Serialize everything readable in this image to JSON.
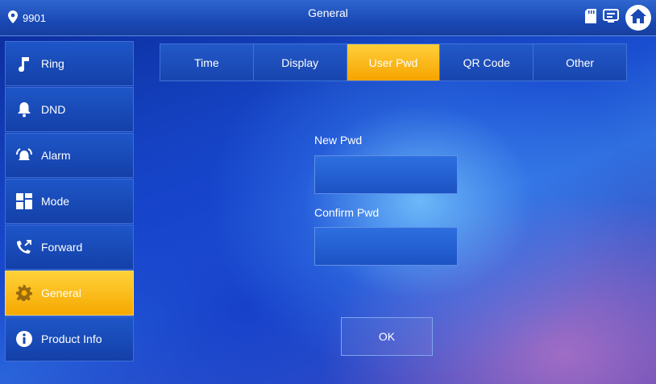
{
  "header": {
    "location_label": "9901",
    "title": "General",
    "icons": [
      "location-pin-icon",
      "sd-card-icon",
      "message-icon",
      "home-icon"
    ]
  },
  "sidebar": {
    "items": [
      {
        "label": "Ring",
        "icon": "music-note-icon",
        "active": false
      },
      {
        "label": "DND",
        "icon": "bell-icon",
        "active": false
      },
      {
        "label": "Alarm",
        "icon": "alarm-icon",
        "active": false
      },
      {
        "label": "Mode",
        "icon": "grid-icon",
        "active": false
      },
      {
        "label": "Forward",
        "icon": "phone-forward-icon",
        "active": false
      },
      {
        "label": "General",
        "icon": "gear-icon",
        "active": true
      },
      {
        "label": "Product Info",
        "icon": "info-icon",
        "active": false
      }
    ]
  },
  "tabs": [
    {
      "label": "Time",
      "active": false
    },
    {
      "label": "Display",
      "active": false
    },
    {
      "label": "User Pwd",
      "active": true
    },
    {
      "label": "QR Code",
      "active": false
    },
    {
      "label": "Other",
      "active": false
    }
  ],
  "form": {
    "new_pwd_label": "New Pwd",
    "new_pwd_value": "",
    "confirm_pwd_label": "Confirm Pwd",
    "confirm_pwd_value": "",
    "ok_label": "OK"
  },
  "colors": {
    "active_accent": "#f6a800",
    "panel_blue": "#1a49b5"
  }
}
